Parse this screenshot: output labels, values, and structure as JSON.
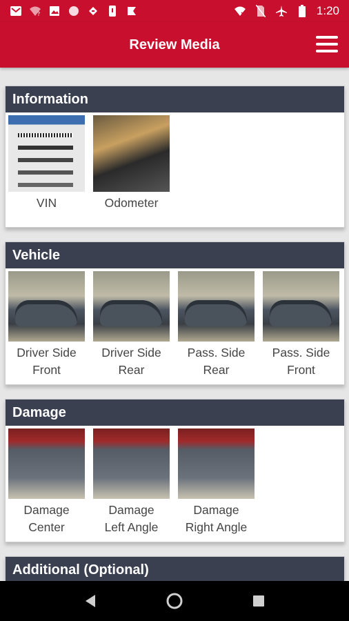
{
  "status_bar": {
    "time": "1:20",
    "left_icons": [
      "gmail-icon",
      "wifi-question-icon",
      "image-icon",
      "circle-icon",
      "sync-icon",
      "phone-alert-icon",
      "flag-icon"
    ],
    "right_icons": [
      "wifi-x-icon",
      "no-sim-icon",
      "airplane-icon",
      "battery-icon"
    ]
  },
  "app_bar": {
    "title": "Review Media",
    "menu_icon": "hamburger-menu-icon"
  },
  "sections": [
    {
      "title": "Information",
      "items": [
        {
          "line1": "VIN",
          "line2": ""
        },
        {
          "line1": "Odometer",
          "line2": ""
        }
      ]
    },
    {
      "title": "Vehicle",
      "items": [
        {
          "line1": "Driver Side",
          "line2": "Front"
        },
        {
          "line1": "Driver Side",
          "line2": "Rear"
        },
        {
          "line1": "Pass. Side",
          "line2": "Rear"
        },
        {
          "line1": "Pass. Side",
          "line2": "Front"
        }
      ]
    },
    {
      "title": "Damage",
      "items": [
        {
          "line1": "Damage",
          "line2": "Center"
        },
        {
          "line1": "Damage",
          "line2": "Left Angle"
        },
        {
          "line1": "Damage",
          "line2": "Right Angle"
        }
      ]
    },
    {
      "title": "Additional (Optional)",
      "items": []
    }
  ],
  "colors": {
    "brand": "#c8102e",
    "section_header": "#3a4050"
  }
}
